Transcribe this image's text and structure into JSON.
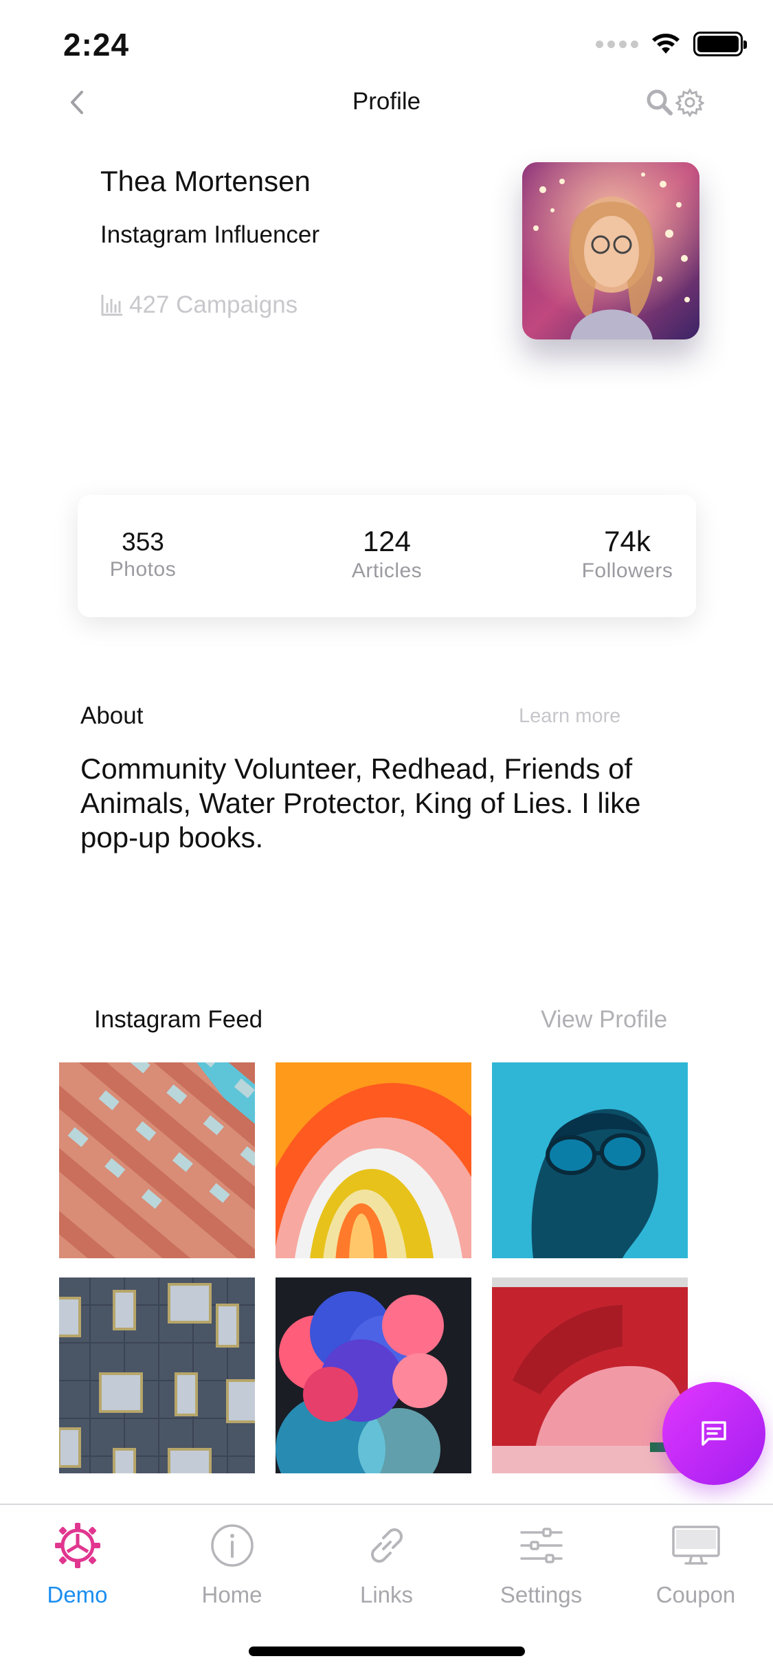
{
  "status_bar": {
    "time": "2:24"
  },
  "nav": {
    "title": "Profile",
    "back_icon": "chevron-left-icon",
    "search_icon": "search-icon",
    "settings_icon": "gear-icon"
  },
  "profile": {
    "name": "Thea Mortensen",
    "role": "Instagram Influencer",
    "campaigns": "427 Campaigns"
  },
  "stats": [
    {
      "value": "353",
      "label": "Photos"
    },
    {
      "value": "124",
      "label": "Articles"
    },
    {
      "value": "74k",
      "label": "Followers"
    }
  ],
  "about": {
    "title": "About",
    "learn_more": "Learn more",
    "text": "Community Volunteer, Redhead, Friends of Animals, Water Protector, King of Lies. I like pop-up books."
  },
  "feed": {
    "title": "Instagram Feed",
    "view_profile": "View Profile"
  },
  "tabs": [
    {
      "label": "Demo",
      "icon": "gear-icon",
      "active": true
    },
    {
      "label": "Home",
      "icon": "info-icon",
      "active": false
    },
    {
      "label": "Links",
      "icon": "link-icon",
      "active": false
    },
    {
      "label": "Settings",
      "icon": "sliders-icon",
      "active": false
    },
    {
      "label": "Coupon",
      "icon": "monitor-icon",
      "active": false
    }
  ],
  "colors": {
    "accent": "#1a8ef0",
    "active_tab_icon": "#e0368f",
    "fab": "#c22cf5"
  }
}
